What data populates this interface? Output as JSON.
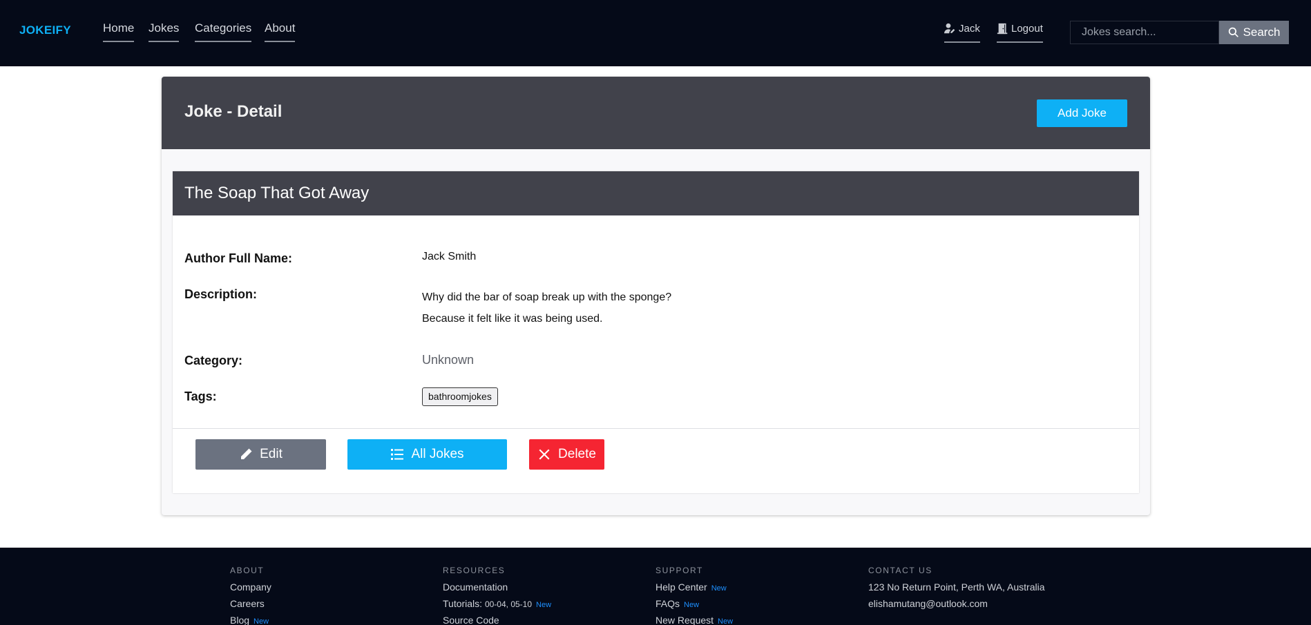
{
  "nav": {
    "brand": "JOKEIFY",
    "links": [
      "Home",
      "Jokes",
      "Categories",
      "About"
    ],
    "user_label": "Jack",
    "logout_label": "Logout",
    "search_placeholder": "Jokes search...",
    "search_button": "Search"
  },
  "page": {
    "title": "Joke - Detail",
    "add_button": "Add Joke"
  },
  "joke": {
    "title": "The Soap That Got Away",
    "author_label": "Author Full Name:",
    "author": "Jack Smith",
    "description_label": "Description:",
    "description_line1": "Why did the bar of soap break up with the sponge?",
    "description_line2": "Because it felt like it was being used.",
    "category_label": "Category:",
    "category": "Unknown",
    "tags_label": "Tags:",
    "tags": [
      "bathroomjokes"
    ]
  },
  "actions": {
    "edit": "Edit",
    "all_jokes": "All Jokes",
    "delete": "Delete"
  },
  "footer": {
    "about": {
      "heading": "ABOUT",
      "items": [
        "Company",
        "Careers",
        "Blog"
      ],
      "new_badge": "New"
    },
    "resources": {
      "heading": "RESOURCES",
      "documentation": "Documentation",
      "tutorials_label": "Tutorials:",
      "tutorials_versions": "00-04, 05-10",
      "source_code": "Source Code",
      "new_badge": "New"
    },
    "support": {
      "heading": "SUPPORT",
      "items": [
        "Help Center",
        "FAQs",
        "New Request"
      ],
      "new_badge": "New"
    },
    "contact": {
      "heading": "CONTACT US",
      "address": "123 No Return Point, Perth WA, Australia",
      "email": "elishamutang@outlook.com"
    }
  },
  "colors": {
    "navbar_bg": "#050a18",
    "brand": "#0eb0f5",
    "header_bg": "#41424b",
    "primary": "#0eb0f5",
    "secondary": "#6b7280",
    "danger": "#f52532",
    "badge_new": "#1e90ff"
  },
  "icons": {
    "user": "user-edit-icon",
    "logout": "door-icon",
    "search": "search-icon",
    "edit": "pencil-icon",
    "all_jokes": "list-icon",
    "delete": "close-icon"
  }
}
